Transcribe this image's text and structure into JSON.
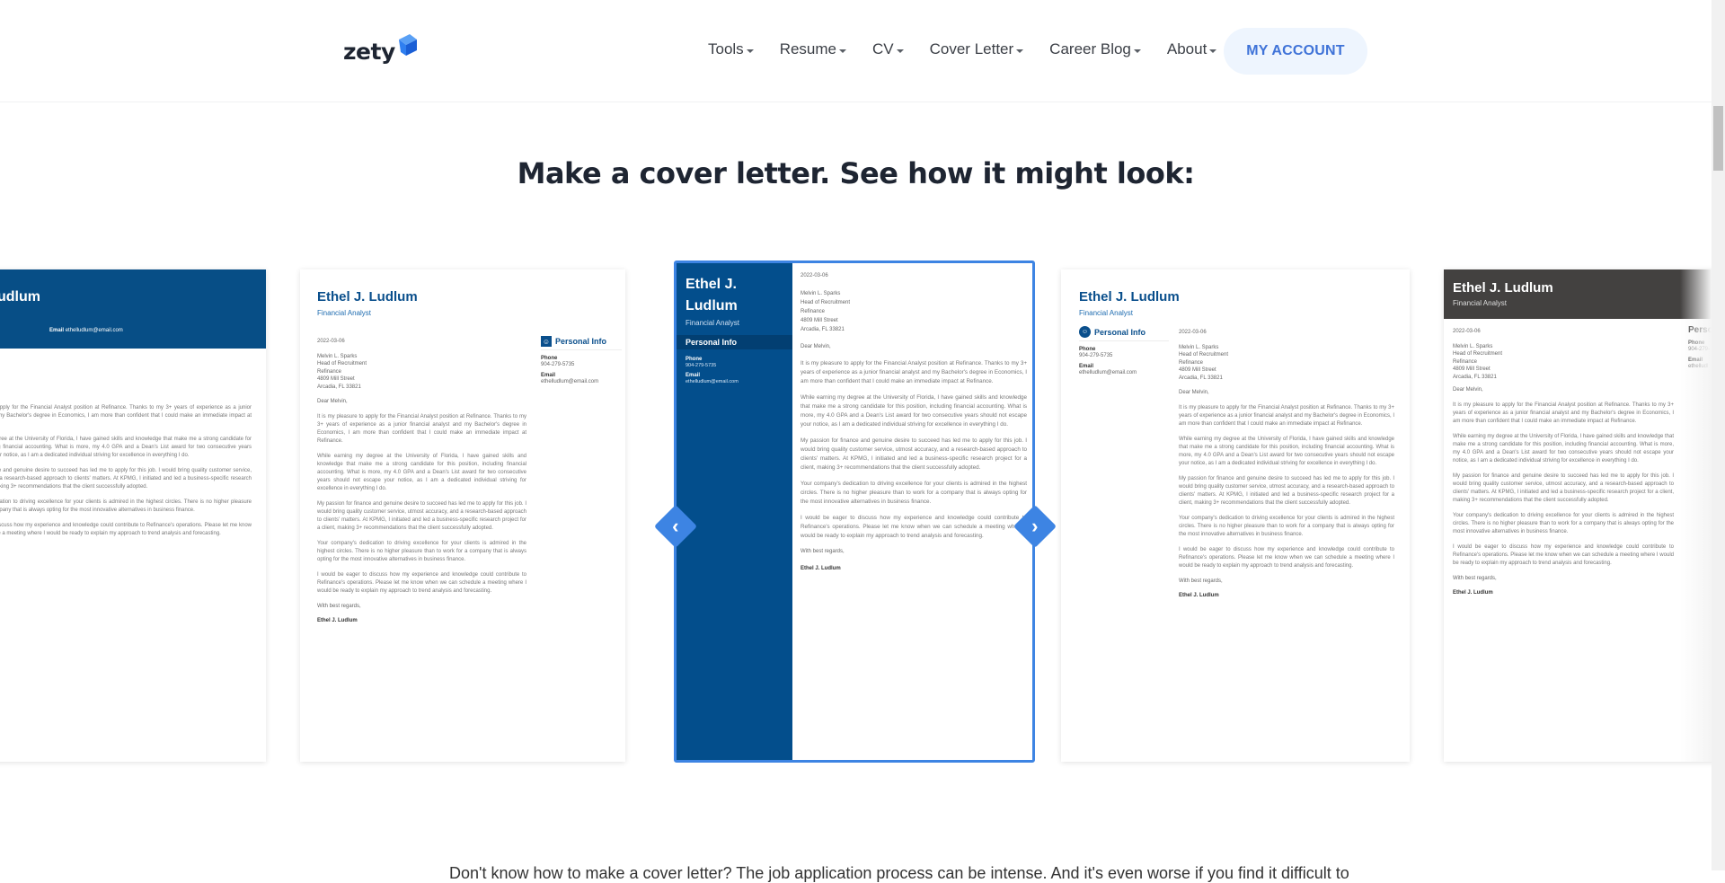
{
  "header": {
    "logo": "zety",
    "nav": [
      {
        "label": "Tools"
      },
      {
        "label": "Resume"
      },
      {
        "label": "CV"
      },
      {
        "label": "Cover Letter"
      },
      {
        "label": "Career Blog"
      },
      {
        "label": "About"
      }
    ],
    "account_label": "MY ACCOUNT"
  },
  "heading": "Make a cover letter. See how it might look:",
  "letter": {
    "name": "Ethel J. Ludlum",
    "name_line1": "Ethel J.",
    "name_line2": "Ludlum",
    "name_cut": "udlum",
    "role": "Financial Analyst",
    "personal_info": "Personal Info",
    "personal_info_cut": "Perso",
    "phone_label": "Phone",
    "phone": "904-279-5735",
    "phone_cut": "904-279-",
    "email_label": "Email",
    "email": "ethelludlum@email.com",
    "email_cut": "ethelludl",
    "date": "2022-03-06",
    "recipient": [
      "Melvin L. Sparks",
      "Head of Recruitment",
      "Refinance",
      "4809 Mill Street",
      "Arcadia, FL 33821"
    ],
    "greeting": "Dear Melvin,",
    "paragraphs": [
      "It is my pleasure to apply for the Financial Analyst position at Refinance. Thanks to my 3+ years of experience as a junior financial analyst and my Bachelor's degree in Economics, I am more than confident that I could make an immediate impact at Refinance.",
      "While earning my degree at the University of Florida, I have gained skills and knowledge that make me a strong candidate for this position, including financial accounting. What is more, my 4.0 GPA and a Dean's List award for two consecutive years should not escape your notice, as I am a dedicated individual striving for excellence in everything I do.",
      "My passion for finance and genuine desire to succeed has led me to apply for this job. I would bring quality customer service, utmost accuracy, and a research-based approach to clients' matters. At KPMG, I initiated and led a business-specific research project for a client, making 3+ recommendations that the client successfully adopted.",
      "Your company's dedication to driving excellence for your clients is admired in the highest circles. There is no higher pleasure than to work for a company that is always opting for the most innovative alternatives in business finance.",
      "I would be eager to discuss how my experience and knowledge could contribute to Refinance's operations. Please let me know when we can schedule a meeting where I would be ready to explain my approach to trend analysis and forecasting."
    ],
    "closing": "With best regards,",
    "signature": "Ethel J. Ludlum"
  },
  "carousel": {
    "prev_icon": "‹",
    "next_icon": "›",
    "accent": "#3d84e3"
  },
  "bottom_text": "Don't know how to make a cover letter? The job application process can be intense. And it's even worse if you find it difficult to"
}
